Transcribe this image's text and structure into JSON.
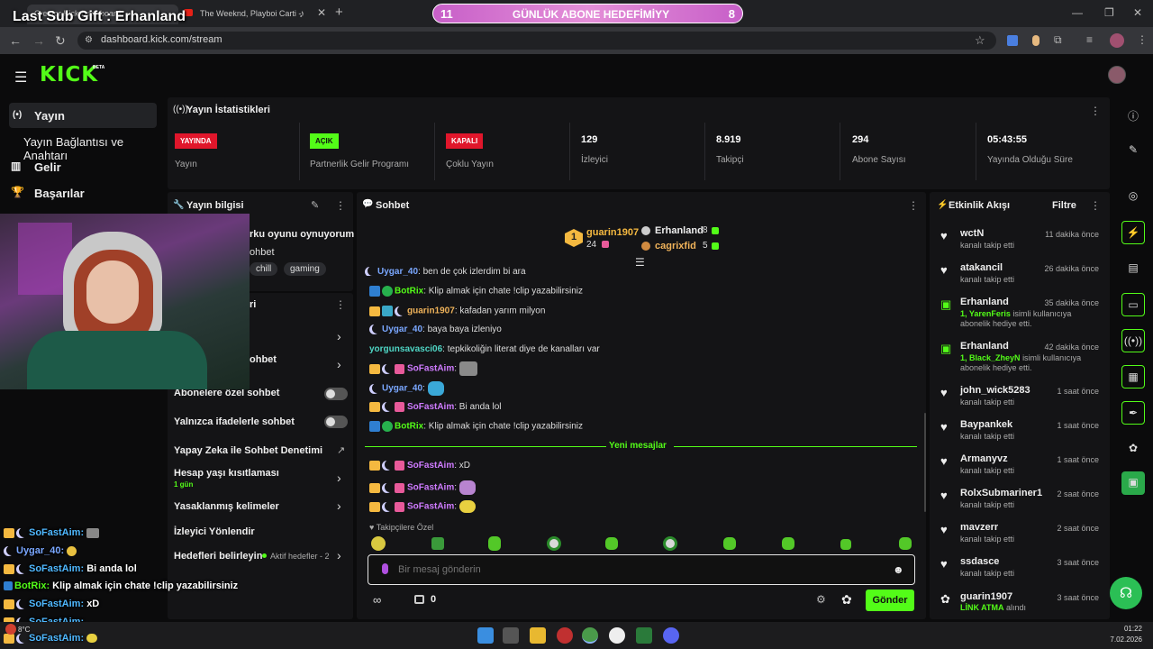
{
  "browser": {
    "tab1": "Creator Kick Dashboard",
    "tab2": "The Weeknd, Playboi Carti - Ti",
    "url": "dashboard.kick.com/stream"
  },
  "overlay": {
    "last_sub": "Last Sub Gift : Erhanland",
    "goal_left": "11",
    "goal_title": "GÜNLÜK ABONE HEDEFİMİYY",
    "goal_right": "8"
  },
  "brand": {
    "logo": "KICK",
    "beta": "BETA",
    "accent": "#53fc18"
  },
  "sidebar": {
    "items": [
      {
        "label": "Yayın"
      },
      {
        "label": "Yayın Bağlantısı ve Anahtarı"
      },
      {
        "label": "Gelir"
      },
      {
        "label": "Başarılar"
      }
    ]
  },
  "stats": {
    "title": "Yayın İstatistikleri",
    "boxes": [
      {
        "badge": "YAYINDA",
        "label": "Yayın",
        "color": "#e0162b"
      },
      {
        "badge": "AÇIK",
        "label": "Partnerlik Gelir Programı",
        "color": "#53fc18"
      },
      {
        "badge": "KAPALI",
        "label": "Çoklu Yayın",
        "color": "#e0162b"
      },
      {
        "value": "129",
        "label": "İzleyici"
      },
      {
        "value": "8.919",
        "label": "Takipçi"
      },
      {
        "value": "294",
        "label": "Abone Sayısı"
      },
      {
        "value": "05:43:55",
        "label": "Yayında Olduğu Süre"
      }
    ]
  },
  "stream_info": {
    "title": "Yayın bilgisi",
    "stream_title": "rku oyunu oynuyorum",
    "category": "ohbet",
    "tags": [
      "chill",
      "gaming"
    ]
  },
  "chat_settings": {
    "title_partial": "ri",
    "rows": [
      {
        "label": "ohbet"
      },
      {
        "label": "Abonelere özel sohbet"
      },
      {
        "label": "Yalnızca ifadelerle sohbet"
      },
      {
        "label": "Yapay Zeka ile Sohbet Denetimi"
      },
      {
        "label": "Hesap yaşı kısıtlaması",
        "sub": "1 gün"
      },
      {
        "label": "Yasaklanmış kelimeler"
      },
      {
        "label": "İzleyici Yönlendir"
      },
      {
        "label": "Hedefleri belirleyin",
        "sub": "Aktif hedefler - 2"
      }
    ]
  },
  "chat": {
    "title": "Sohbet",
    "top_gifters": [
      {
        "rank": "1",
        "name": "guarin1907",
        "count": "24"
      },
      {
        "name": "Erhanland",
        "count": "8"
      },
      {
        "name": "cagrixfid",
        "count": "5"
      }
    ],
    "messages": [
      {
        "user": "Uygar_40",
        "text": "ben de çok izlerdim bi ara"
      },
      {
        "user": "BotRix",
        "text": "Klip almak için chate !clip yazabilirsiniz"
      },
      {
        "user": "guarin1907",
        "text": "kafadan yarım milyon"
      },
      {
        "user": "Uygar_40",
        "text": "baya baya izleniyo"
      },
      {
        "user": "yorgunsavasci06",
        "text": "tepkikoliğin literat diye de kanalları var"
      },
      {
        "user": "SoFastAim",
        "text": ""
      },
      {
        "user": "Uygar_40",
        "text": ""
      },
      {
        "user": "SoFastAim",
        "text": "Bi anda lol"
      },
      {
        "user": "BotRix",
        "text": "Klip almak için chate !clip yazabilirsiniz"
      },
      {
        "user": "SoFastAim",
        "text": "xD"
      },
      {
        "user": "SoFastAim",
        "text": ""
      },
      {
        "user": "SoFastAim",
        "text": ""
      }
    ],
    "new_messages": "Yeni mesajlar",
    "followers_only": "Takipçilere Özel",
    "input_placeholder": "Bir mesaj gönderin",
    "points": "0",
    "send": "Gönder"
  },
  "events": {
    "title": "Etkinlik Akışı",
    "filter": "Filtre",
    "items": [
      {
        "name": "wctN",
        "sub": "kanalı takip etti",
        "time": "11 dakika önce",
        "icon": "heart-icon"
      },
      {
        "name": "atakancil",
        "sub": "kanalı takip etti",
        "time": "26 dakika önce",
        "icon": "heart-icon"
      },
      {
        "name": "Erhanland",
        "highlight": "1, YarenFeris",
        "sub": "isimli kullanıcıya abonelik hediye etti.",
        "time": "35 dakika önce",
        "icon": "gift-icon"
      },
      {
        "name": "Erhanland",
        "highlight": "1, Black_ZheyN",
        "sub": "isimli kullanıcıya abonelik hediye etti.",
        "time": "42 dakika önce",
        "icon": "gift-icon"
      },
      {
        "name": "john_wick5283",
        "sub": "kanalı takip etti",
        "time": "1 saat önce",
        "icon": "heart-icon"
      },
      {
        "name": "Baypankek",
        "sub": "kanalı takip etti",
        "time": "1 saat önce",
        "icon": "heart-icon"
      },
      {
        "name": "Armanyvz",
        "sub": "kanalı takip etti",
        "time": "1 saat önce",
        "icon": "heart-icon"
      },
      {
        "name": "RolxSubmariner1",
        "sub": "kanalı takip etti",
        "time": "2 saat önce",
        "icon": "heart-icon"
      },
      {
        "name": "mavzerr",
        "sub": "kanalı takip etti",
        "time": "2 saat önce",
        "icon": "heart-icon"
      },
      {
        "name": "ssdasce",
        "sub": "kanalı takip etti",
        "time": "3 saat önce",
        "icon": "heart-icon"
      },
      {
        "name": "guarin1907",
        "highlight": "LİNK ATMA",
        "sub": "alındı",
        "time": "3 saat önce",
        "icon": "points-icon"
      }
    ]
  },
  "overlay_chat": [
    {
      "user": "SoFastAim:",
      "text": ""
    },
    {
      "user": "Uygar_40:",
      "text": ""
    },
    {
      "user": "SoFastAim:",
      "text": "Bi anda lol"
    },
    {
      "user": "BotRix:",
      "text": "Klip almak için chate !clip yazabilirsiniz"
    },
    {
      "user": "SoFastAim:",
      "text": "xD"
    },
    {
      "user": "SoFastAim:",
      "text": ""
    },
    {
      "user": "SoFastAim:",
      "text": ""
    }
  ],
  "weather": {
    "temp": "8°C"
  },
  "clock": {
    "time": "01:22",
    "date": "7.02.2026"
  }
}
